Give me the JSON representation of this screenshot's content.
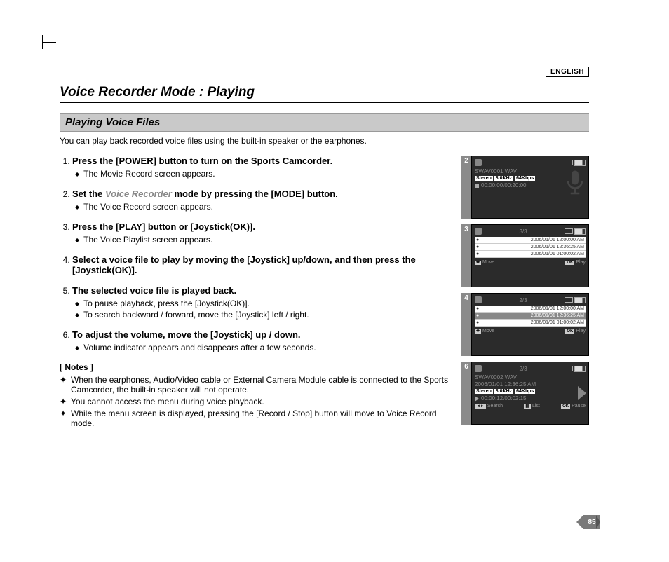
{
  "lang": "ENGLISH",
  "title": "Voice Recorder Mode : Playing",
  "subtitle": "Playing Voice Files",
  "intro": "You can play back recorded voice files using the built-in speaker or the earphones.",
  "steps": [
    {
      "head_pre": "Press the [POWER] button to turn on the Sports Camcorder.",
      "subs": [
        "The Movie Record screen appears."
      ]
    },
    {
      "head_pre": "Set the ",
      "em": "Voice Recorder",
      "head_post": " mode by pressing the [MODE] button.",
      "subs": [
        "The Voice Record screen appears."
      ]
    },
    {
      "head_pre": "Press the [PLAY] button or [Joystick(OK)].",
      "subs": [
        "The Voice Playlist screen appears."
      ]
    },
    {
      "head_pre": "Select a voice file to play by moving the [Joystick] up/down, and then press the [Joystick(OK)].",
      "subs": []
    },
    {
      "head_pre": "The selected voice file is played back.",
      "subs": [
        "To pause playback, press the [Joystick(OK)].",
        "To search backward / forward, move the [Joystick] left / right."
      ]
    },
    {
      "head_pre": "To adjust the volume, move the [Joystick] up / down.",
      "subs": [
        "Volume indicator appears and disappears after a few seconds."
      ]
    }
  ],
  "notes_head": "[ Notes ]",
  "notes": [
    "When the earphones, Audio/Video cable or External Camera Module cable is connected to the Sports Camcorder, the built-in speaker will not operate.",
    "You cannot access the menu during voice playback.",
    "While the menu screen is displayed, pressing the [Record / Stop] button will move to Voice Record mode."
  ],
  "screens": {
    "s2": {
      "num": "2",
      "fname": "SWAV0001.WAV",
      "pills": [
        "Stereo",
        "8.0KHz",
        "64Kbps"
      ],
      "time": "00:00:00/00:20:00"
    },
    "s3": {
      "num": "3",
      "counter": "3/3",
      "rows": [
        {
          "l": "2006/01/01 12:00:00 AM"
        },
        {
          "l": "2006/01/01 12:36:25 AM"
        },
        {
          "l": "2006/01/01 01:00:02 AM"
        }
      ],
      "b1": "Move",
      "b2": "Play"
    },
    "s4": {
      "num": "4",
      "counter": "2/3",
      "rows": [
        {
          "l": "2006/01/01 12:00:00 AM"
        },
        {
          "l": "2006/01/01 12:36:25 AM",
          "sel": true
        },
        {
          "l": "2006/01/01 01:00:02 AM"
        }
      ],
      "b1": "Move",
      "b2": "Play"
    },
    "s6": {
      "num": "6",
      "counter": "2/3",
      "fname": "SWAV0002.WAV",
      "sub": "2006/01/01 12:36:25 AM",
      "pills": [
        "Stereo",
        "8.0KHz",
        "64Kbps"
      ],
      "time": "00:00:12/00:02:15",
      "b1": "Search",
      "b2": "List",
      "b3": "Pause"
    }
  },
  "page_number": "85"
}
